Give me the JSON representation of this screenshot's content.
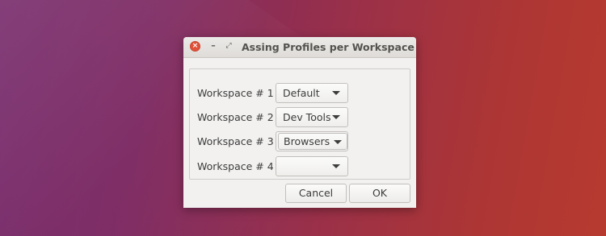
{
  "window": {
    "title": "Assing Profiles per Workspace",
    "close_glyph": "×",
    "minimize_glyph": "–",
    "maximize_glyph": "⤢"
  },
  "workspaces": [
    {
      "label": "Workspace # 1",
      "selected": "Default"
    },
    {
      "label": "Workspace # 2",
      "selected": "Dev Tools"
    },
    {
      "label": "Workspace # 3",
      "selected": "Browsers"
    },
    {
      "label": "Workspace # 4",
      "selected": ""
    }
  ],
  "buttons": {
    "cancel_label": "Cancel",
    "ok_label": "OK"
  },
  "colors": {
    "close_button": "#e0533a",
    "window_bg": "#f2f1f0"
  },
  "icons": {
    "close": "close-icon",
    "minimize": "minimize-icon",
    "maximize": "maximize-icon",
    "dropdown": "chevron-down-icon"
  }
}
